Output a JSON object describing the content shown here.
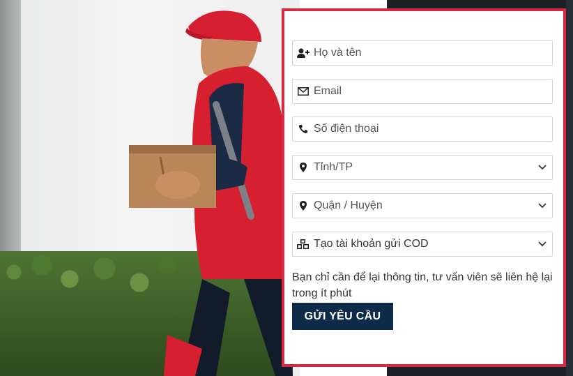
{
  "form": {
    "name_placeholder": "Họ và tên",
    "email_placeholder": "Email",
    "phone_placeholder": "Số điện thoại",
    "province_select": "Tỉnh/TP",
    "district_select": "Quận / Huyện",
    "account_select": "Tạo tài khoản gửi COD",
    "note_text": "Bạn chỉ cần để lại thông tin, tư vấn viên sẽ liên hệ lại trong ít phút",
    "submit_label": "GỬI YÊU CẦU"
  },
  "colors": {
    "form_border": "#d62a43",
    "submit_bg": "#0f2b4a"
  },
  "icons": [
    "user-plus-icon",
    "envelope-icon",
    "phone-icon",
    "map-marker-icon",
    "map-marker-icon",
    "cubes-icon",
    "chevron-down-icon"
  ]
}
